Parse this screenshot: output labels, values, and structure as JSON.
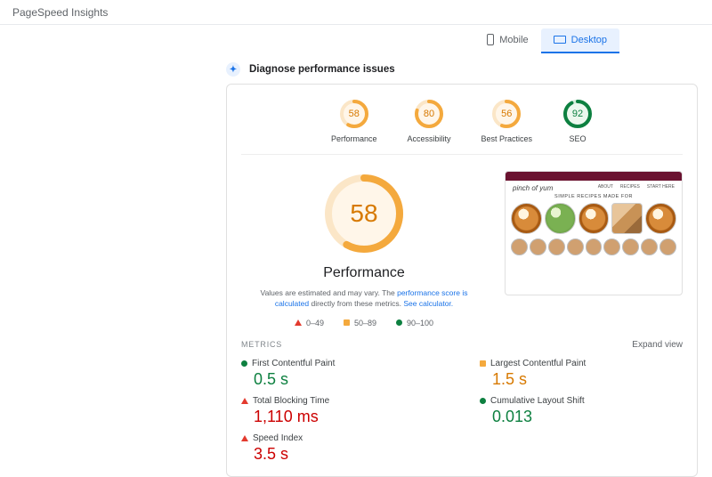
{
  "app_title": "PageSpeed Insights",
  "tabs": {
    "mobile": "Mobile",
    "desktop": "Desktop",
    "active": "desktop"
  },
  "diagnose_header": "Diagnose performance issues",
  "scores": [
    {
      "label": "Performance",
      "value": 58,
      "tier": "mid"
    },
    {
      "label": "Accessibility",
      "value": 80,
      "tier": "mid"
    },
    {
      "label": "Best Practices",
      "value": 56,
      "tier": "mid"
    },
    {
      "label": "SEO",
      "value": 92,
      "tier": "good"
    }
  ],
  "hero": {
    "score": 58,
    "title": "Performance",
    "note_pre": "Values are estimated and may vary. The ",
    "note_link1": "performance score is calculated",
    "note_mid": " directly from these metrics. ",
    "note_link2": "See calculator."
  },
  "legend": {
    "poor": "0–49",
    "mid": "50–89",
    "good": "90–100"
  },
  "thumbnail": {
    "logo": "pinch of yum",
    "nav": [
      "ABOUT",
      "RECIPES",
      "START HERE"
    ],
    "subtitle": "SIMPLE RECIPES MADE FOR"
  },
  "metrics_header": "METRICS",
  "expand_view": "Expand view",
  "metrics": {
    "fcp": {
      "label": "First Contentful Paint",
      "value": "0.5 s",
      "status": "good"
    },
    "lcp": {
      "label": "Largest Contentful Paint",
      "value": "1.5 s",
      "status": "mid"
    },
    "tbt": {
      "label": "Total Blocking Time",
      "value": "1,110 ms",
      "status": "poor"
    },
    "cls": {
      "label": "Cumulative Layout Shift",
      "value": "0.013",
      "status": "good"
    },
    "si": {
      "label": "Speed Index",
      "value": "3.5 s",
      "status": "poor"
    }
  },
  "colors": {
    "poor": "#cc0000",
    "mid": "#f4a93d",
    "mid_text": "#d77900",
    "good": "#0d8040",
    "link": "#1a73e8"
  }
}
